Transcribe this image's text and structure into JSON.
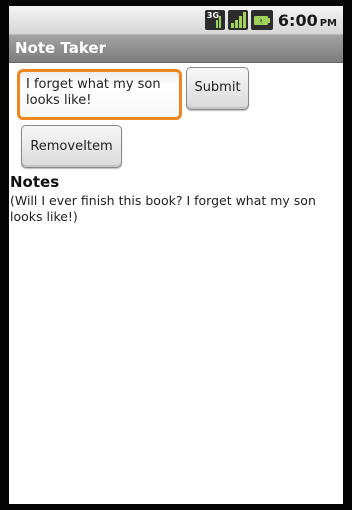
{
  "status_bar": {
    "network_badge": "3G",
    "icons": [
      "network-3g-icon",
      "signal-icon",
      "battery-icon"
    ],
    "time": "6:00",
    "ampm": "PM"
  },
  "app": {
    "title": "Note Taker"
  },
  "form": {
    "note_value": "I forget what my son looks like!",
    "submit_label": "Submit",
    "remove_label": "RemoveItem"
  },
  "notes": {
    "heading": "Notes",
    "content": "(Will I ever finish this book? I forget what my son looks like!)"
  },
  "colors": {
    "focus_border": "#f0861f",
    "title_bar": "#8e8e8e",
    "frame": "#050505"
  }
}
